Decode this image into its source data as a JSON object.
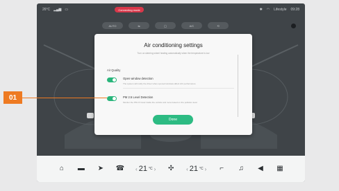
{
  "statusbar": {
    "time_left": "26°C",
    "status_text": "Connecting mode",
    "user": "Lifestyle",
    "time_right": "09:28"
  },
  "modes": [
    "AUTO",
    "",
    "",
    "A/C",
    ""
  ],
  "modal": {
    "title": "Air conditioning settings",
    "subtitle": "Turn on steering wheel heating automatically when the temperature is low",
    "section": "Air Quality",
    "rows": [
      {
        "title": "Open window detection",
        "desc": "The system will notify the driver when opened windows affect A/C performance",
        "enabled": true
      },
      {
        "title": "PM 2.5 Level Detection",
        "desc": "Monitor the PM 2.5 level inside the vehicle and more based on the pollution level",
        "enabled": true
      }
    ],
    "done_label": "Done"
  },
  "callout": {
    "label": "01",
    "color": "#ee7a22"
  },
  "dock": {
    "icons": [
      "home-icon",
      "car-icon",
      "navigation-icon",
      "phone-icon",
      "fan-icon",
      "seat-icon",
      "music-icon",
      "volume-icon",
      "apps-icon"
    ],
    "left_temp": "21",
    "right_temp": "21",
    "temp_unit": "°C"
  },
  "colors": {
    "accent": "#2dbb83",
    "status_red": "#d9384a"
  }
}
